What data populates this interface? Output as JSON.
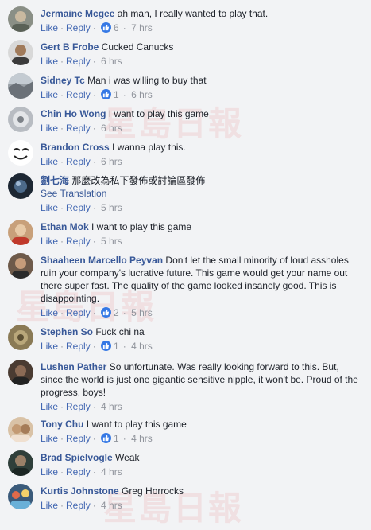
{
  "watermark": "星島日報",
  "comments": [
    {
      "name": "Jermaine Mcgee",
      "text": "ah man, I really wanted to play that.",
      "like": "Like",
      "reply": "Reply",
      "reactions": "6",
      "time": "7 hrs"
    },
    {
      "name": "Gert B Frobe",
      "text": "Cucked Canucks",
      "like": "Like",
      "reply": "Reply",
      "time": "6 hrs"
    },
    {
      "name": "Sidney Tc",
      "text": "Man i was willing to buy that",
      "like": "Like",
      "reply": "Reply",
      "reactions": "1",
      "time": "6 hrs"
    },
    {
      "name": "Chin Ho Wong",
      "text": "I want to play this game",
      "like": "Like",
      "reply": "Reply",
      "time": "6 hrs"
    },
    {
      "name": "Brandon Cross",
      "text": "I wanna play this.",
      "like": "Like",
      "reply": "Reply",
      "time": "6 hrs"
    },
    {
      "name": "劉七海",
      "text": "那麼改為私下發佈或討論區發佈",
      "see_translation": "See Translation",
      "like": "Like",
      "reply": "Reply",
      "time": "5 hrs"
    },
    {
      "name": "Ethan Mok",
      "text": "I want to play this game",
      "like": "Like",
      "reply": "Reply",
      "time": "5 hrs"
    },
    {
      "name": "Shaaheen Marcello Peyvan",
      "text": "Don't let the small minority of loud assholes ruin your company's lucrative future. This game would get your name out there super fast. The quality of the game looked insanely good. This is disappointing.",
      "like": "Like",
      "reply": "Reply",
      "reactions": "2",
      "time": "5 hrs"
    },
    {
      "name": "Stephen So",
      "text": "Fuck chi na",
      "like": "Like",
      "reply": "Reply",
      "reactions": "1",
      "time": "4 hrs"
    },
    {
      "name": "Lushen Pather",
      "text": "So unfortunate. Was really looking forward to this. But, since the world is just one gigantic sensitive nipple, it won't be. Proud of the progress, boys!",
      "like": "Like",
      "reply": "Reply",
      "time": "4 hrs"
    },
    {
      "name": "Tony Chu",
      "text": "I want to play this game",
      "like": "Like",
      "reply": "Reply",
      "reactions": "1",
      "time": "4 hrs"
    },
    {
      "name": "Brad Spielvogle",
      "text": "Weak",
      "like": "Like",
      "reply": "Reply",
      "time": "4 hrs"
    },
    {
      "name": "Kurtis Johnstone",
      "text": "Greg Horrocks",
      "like": "Like",
      "reply": "Reply",
      "time": "4 hrs"
    }
  ],
  "colors": {
    "name": "#385898",
    "action": "#4267b2",
    "meta": "#90949c",
    "reaction": "#3578e5",
    "background": "#f2f3f5"
  },
  "icons": {
    "reaction": "thumbs-up-icon"
  }
}
